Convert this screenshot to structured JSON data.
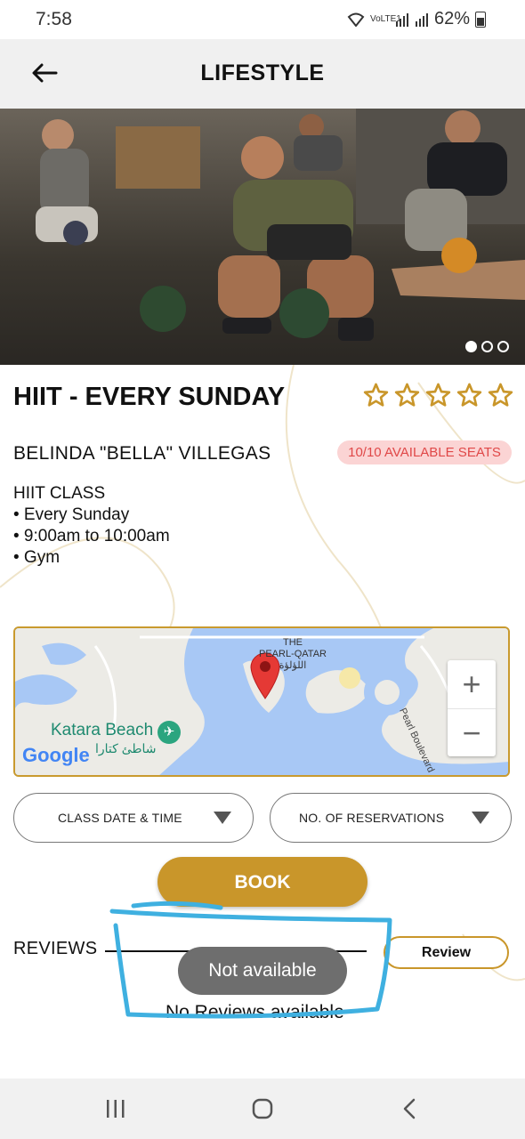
{
  "status_bar": {
    "time": "7:58",
    "network_label": "VoLTE1",
    "battery_percent": "62%"
  },
  "app_bar": {
    "title": "LIFESTYLE",
    "back_icon": "arrow-left-icon"
  },
  "hero": {
    "slide_count": 3,
    "active_slide": 1
  },
  "class_info": {
    "title": "HIIT - EVERY SUNDAY",
    "rating": 0,
    "rating_max": 5,
    "instructor": "BELINDA \"BELLA\" VILLEGAS",
    "seats": "10/10 AVAILABLE SEATS",
    "description": {
      "heading": "HIIT CLASS",
      "bullets": [
        "• Every Sunday",
        "• 9:00am to 10:00am",
        "• Gym"
      ]
    }
  },
  "map": {
    "pin_label_line1": "THE",
    "pin_label_line2": "PEARL-QATAR",
    "pin_label_arabic": "اللؤلؤة",
    "beach_label": "Katara Beach",
    "beach_label_arabic": "شاطئ كتارا",
    "road_label": "Pearl Boulevard",
    "attribution": "Google",
    "zoom_in": "+",
    "zoom_out": "−"
  },
  "selectors": {
    "date_time": "CLASS DATE & TIME",
    "reservations": "NO. OF RESERVATIONS"
  },
  "actions": {
    "book": "BOOK"
  },
  "reviews": {
    "title": "REVIEWS",
    "review_button": "Review",
    "empty_message": "No Reviews available"
  },
  "toast": {
    "message": "Not available"
  },
  "colors": {
    "accent": "#c9962a",
    "badge_bg": "#fbd4d4",
    "badge_text": "#e04848",
    "annotation": "#3fb0e0"
  }
}
